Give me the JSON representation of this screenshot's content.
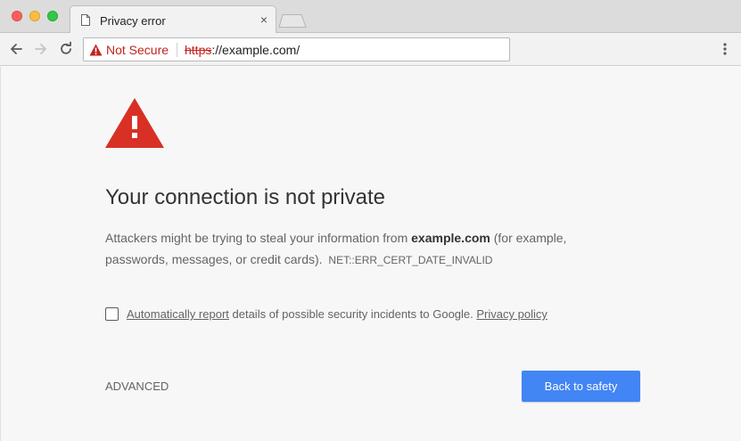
{
  "window": {
    "tab_title": "Privacy error",
    "tab_close_glyph": "×"
  },
  "toolbar": {
    "security_label": "Not Secure",
    "url_scheme": "https",
    "url_rest": "://example.com/"
  },
  "error_page": {
    "heading": "Your connection is not private",
    "para_before": "Attackers might be trying to steal your information from ",
    "para_domain": "example.com",
    "para_after": " (for example, passwords, messages, or credit cards).",
    "error_code": "NET::ERR_CERT_DATE_INVALID",
    "report_link": "Automatically report",
    "report_text": " details of possible security incidents to Google. ",
    "privacy_link": "Privacy policy",
    "advanced_label": "ADVANCED",
    "back_label": "Back to safety"
  },
  "icons": {
    "tab_icon": "page-icon",
    "back": "arrow-left-icon",
    "forward": "arrow-right-icon",
    "reload": "reload-icon",
    "security": "warning-triangle-icon",
    "menu": "vertical-dots-icon",
    "page_warning": "warning-triangle-icon"
  },
  "colors": {
    "not_secure_red": "#c5221f",
    "warning_red": "#d93025",
    "button_blue": "#4285f4",
    "page_background": "#f7f7f7"
  }
}
